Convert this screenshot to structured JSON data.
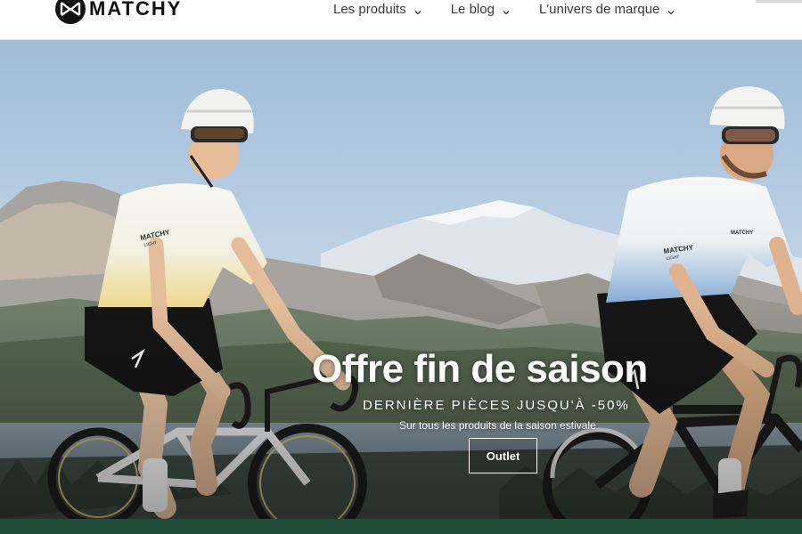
{
  "header": {
    "brand": "MATCHY",
    "logo_icon": "matchy-logo-icon",
    "nav": [
      {
        "label": "Les produits",
        "icon": "chevron-down-icon"
      },
      {
        "label": "Le blog",
        "icon": "chevron-down-icon"
      },
      {
        "label": "L'univers de marque",
        "icon": "chevron-down-icon"
      }
    ]
  },
  "hero": {
    "title": "Offre fin de saison",
    "subtitle": "DERNIÈRE PIÈCES JUSQU'À -50%",
    "note": "Sur tous les produits de la saison estivale",
    "cta_label": "Outlet",
    "jersey_brand": "MATCHY",
    "jersey_sub": "LIGHT"
  },
  "colors": {
    "accent": "#1f4d3a",
    "sky": "#a9c6df",
    "text": "#3a3a3a"
  }
}
